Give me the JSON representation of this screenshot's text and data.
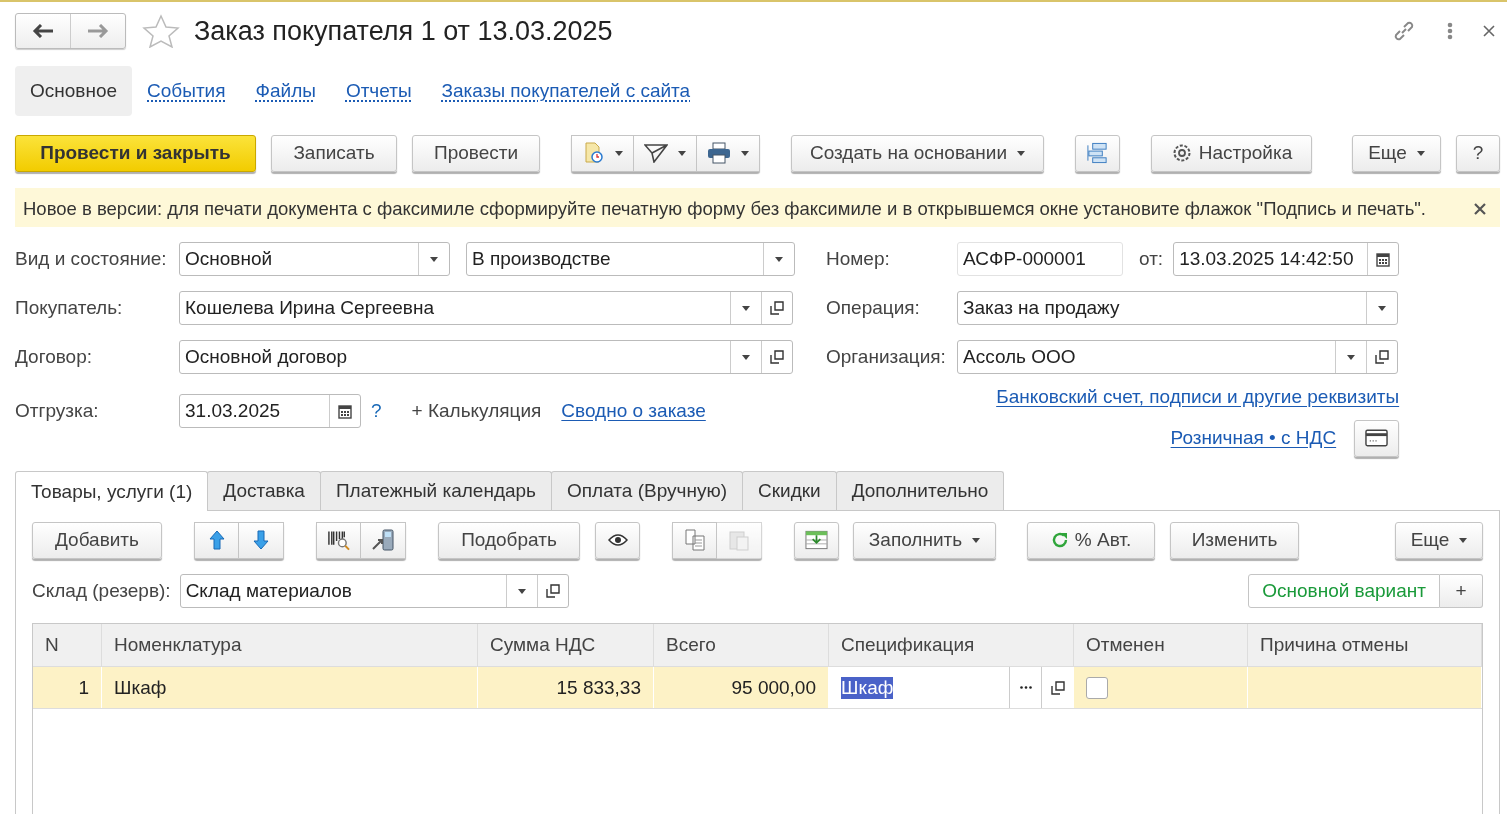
{
  "window": {
    "title": "Заказ покупателя 1 от 13.03.2025",
    "favorite": false
  },
  "sections": [
    {
      "label": "Основное",
      "selected": true
    },
    {
      "label": "События",
      "selected": false
    },
    {
      "label": "Файлы",
      "selected": false
    },
    {
      "label": "Отчеты",
      "selected": false
    },
    {
      "label": "Заказы покупателей с сайта",
      "selected": false
    }
  ],
  "command_bar": {
    "post_and_close": "Провести и закрыть",
    "write": "Записать",
    "post": "Провести",
    "create_based": "Создать на основании",
    "settings": "Настройка",
    "more": "Еще",
    "help": "?"
  },
  "notice": {
    "text": "Новое в версии: для печати документа с факсимиле сформируйте печатную форму без факсимиле и в открывшемся окне установите флажок \"Подпись и печать\"."
  },
  "header": {
    "kind_state": {
      "label": "Вид и состояние:",
      "kind": "Основной",
      "state": "В производстве"
    },
    "customer": {
      "label": "Покупатель:",
      "value": "Кошелева Ирина Сергеевна"
    },
    "contract": {
      "label": "Договор:",
      "value": "Основной договор"
    },
    "shipment": {
      "label": "Отгрузка:",
      "value": "31.03.2025",
      "help": "?",
      "calculation": "+ Калькуляция",
      "summary_link": "Сводно о заказе"
    },
    "number": {
      "label": "Номер:",
      "value": "АСФР-000001",
      "date_label": "от:",
      "date": "13.03.2025 14:42:50"
    },
    "operation": {
      "label": "Операция:",
      "value": "Заказ на продажу"
    },
    "organization": {
      "label": "Организация:",
      "value": "Ассоль ООО"
    },
    "bank_link": "Банковский счет, подписи и другие реквизиты",
    "price_link": "Розничная • с НДС"
  },
  "tabs": [
    {
      "label": "Товары, услуги (1)",
      "selected": true
    },
    {
      "label": "Доставка",
      "selected": false
    },
    {
      "label": "Платежный календарь",
      "selected": false
    },
    {
      "label": "Оплата (Вручную)",
      "selected": false
    },
    {
      "label": "Скидки",
      "selected": false
    },
    {
      "label": "Дополнительно",
      "selected": false
    }
  ],
  "tab_toolbar": {
    "add": "Добавить",
    "pick": "Подобрать",
    "fill": "Заполнить",
    "auto": "% Авт.",
    "change": "Изменить",
    "more": "Еще"
  },
  "warehouse": {
    "label": "Склад (резерв):",
    "value": "Склад материалов"
  },
  "variant": {
    "label": "Основной вариант",
    "add": "+"
  },
  "table": {
    "columns": [
      "N",
      "Номенклатура",
      "Сумма НДС",
      "Всего",
      "Спецификация",
      "Отменен",
      "Причина отмены"
    ],
    "rows": [
      {
        "n": "1",
        "item": "Шкаф",
        "vat": "15 833,33",
        "total": "95 000,00",
        "spec": "Шкаф",
        "editing": true,
        "cancelled": false,
        "selected": true
      }
    ]
  }
}
